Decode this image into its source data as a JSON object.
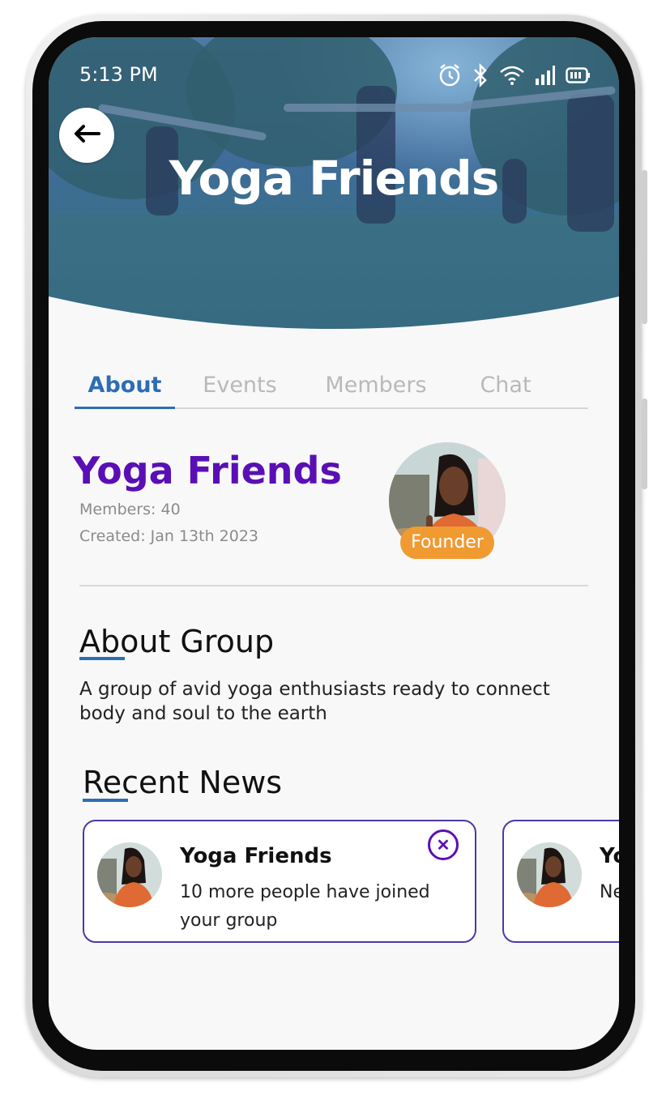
{
  "status_bar": {
    "time": "5:13 PM",
    "icons": [
      "alarm-icon",
      "bluetooth-icon",
      "wifi-icon",
      "signal-icon",
      "battery-icon"
    ]
  },
  "header": {
    "title": "Yoga Friends",
    "back_icon": "arrow-left-icon"
  },
  "tabs": [
    {
      "label": "About",
      "active": true
    },
    {
      "label": "Events",
      "active": false
    },
    {
      "label": "Members",
      "active": false
    },
    {
      "label": "Chat",
      "active": false
    }
  ],
  "group": {
    "name": "Yoga Friends",
    "members": "Members: 40",
    "created": "Created: Jan 13th 2023",
    "founder_badge": "Founder"
  },
  "about": {
    "heading": "About Group",
    "text": "A group of avid yoga enthusiasts ready to connect body and soul to the earth"
  },
  "recent_news": {
    "heading": "Recent News",
    "items": [
      {
        "title": "Yoga Friends",
        "body": "10 more people have joined your group",
        "close_icon": "close-icon"
      },
      {
        "title": "Yo",
        "body": "Ne"
      }
    ]
  },
  "colors": {
    "accent_blue": "#2e6db4",
    "purple": "#5a0fb5",
    "founder_orange": "#f09a32"
  }
}
